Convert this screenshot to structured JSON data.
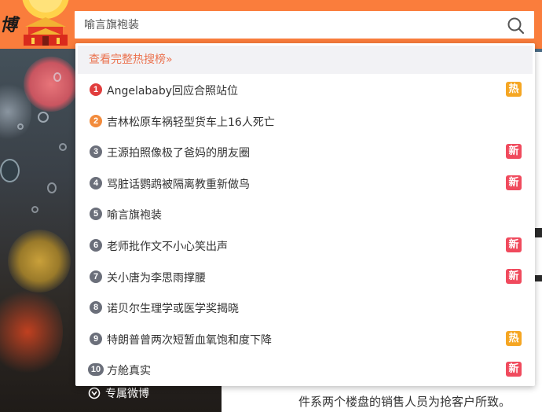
{
  "header": {
    "logo_text": "博"
  },
  "search": {
    "placeholder": "喻言旗袍装"
  },
  "hot_search": {
    "view_all_label": "查看完整热搜榜»",
    "items": [
      {
        "rank": "1",
        "title": "Angelababy回应合照站位",
        "badge": "热",
        "rank_color": "#e13d3d",
        "badge_color": "#f5a623"
      },
      {
        "rank": "2",
        "title": "吉林松原车祸轻型货车上16人死亡",
        "badge": "",
        "rank_color": "#f28b3c",
        "badge_color": ""
      },
      {
        "rank": "3",
        "title": "王源拍照像极了爸妈的朋友圈",
        "badge": "新",
        "rank_color": "#6b6f7a",
        "badge_color": "#f04a5d"
      },
      {
        "rank": "4",
        "title": "骂脏话鹦鹉被隔离教重新做鸟",
        "badge": "新",
        "rank_color": "#6b6f7a",
        "badge_color": "#f04a5d"
      },
      {
        "rank": "5",
        "title": "喻言旗袍装",
        "badge": "",
        "rank_color": "#6b6f7a",
        "badge_color": ""
      },
      {
        "rank": "6",
        "title": "老师批作文不小心笑出声",
        "badge": "新",
        "rank_color": "#6b6f7a",
        "badge_color": "#f04a5d"
      },
      {
        "rank": "7",
        "title": "关小唐为李思雨撑腰",
        "badge": "新",
        "rank_color": "#6b6f7a",
        "badge_color": "#f04a5d"
      },
      {
        "rank": "8",
        "title": "诺贝尔生理学或医学奖揭晓",
        "badge": "",
        "rank_color": "#6b6f7a",
        "badge_color": ""
      },
      {
        "rank": "9",
        "title": "特朗普曾两次短暂血氧饱和度下降",
        "badge": "热",
        "rank_color": "#6b6f7a",
        "badge_color": "#f5a623"
      },
      {
        "rank": "10",
        "title": "方舱真实",
        "badge": "新",
        "rank_color": "#6b6f7a",
        "badge_color": "#f04a5d"
      }
    ]
  },
  "sidebar": {
    "exclusive_label": "专属微博"
  },
  "article": {
    "line_1": "件系两个楼盘的销售人员为抢客户所致。"
  },
  "icons": {
    "search": "search-icon",
    "exclusive": "exclusive-icon"
  },
  "colors": {
    "brand_orange": "#fa7d3c",
    "link_orange": "#eb7350",
    "hot_badge": "#f5a623",
    "new_badge": "#f04a5d"
  }
}
